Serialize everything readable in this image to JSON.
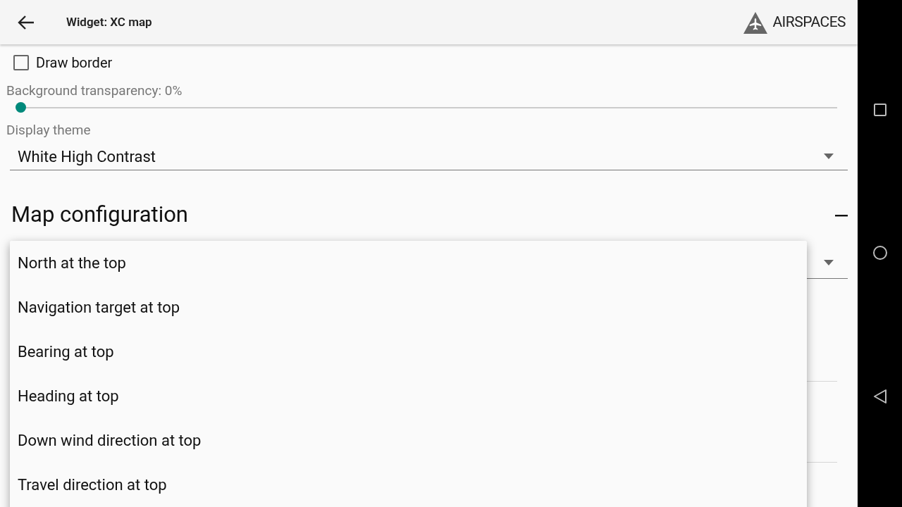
{
  "header": {
    "title": "Widget: XC map",
    "brand": "AIRSPACES"
  },
  "draw_border": {
    "label": "Draw border",
    "checked": false
  },
  "transparency": {
    "label": "Background transparency: 0%",
    "level": 0
  },
  "display_theme": {
    "label": "Display theme",
    "value": "White High Contrast"
  },
  "section": {
    "title": "Map configuration",
    "expanded": true
  },
  "menu": [
    {
      "label": "North at the top"
    },
    {
      "label": "Navigation target at top"
    },
    {
      "label": "Bearing at top"
    },
    {
      "label": "Heading at top"
    },
    {
      "label": "Down wind direction at top"
    },
    {
      "label": "Travel direction at top"
    }
  ]
}
